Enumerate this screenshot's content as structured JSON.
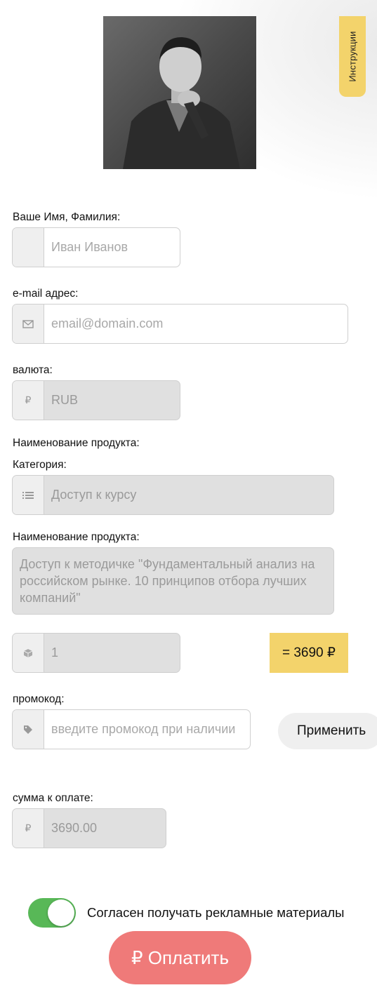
{
  "header": {
    "instructions_tab": "Инструкции"
  },
  "form": {
    "name": {
      "label": "Ваше Имя, Фамилия:",
      "placeholder": "Иван Иванов"
    },
    "email": {
      "label": "e-mail адрес:",
      "placeholder": "email@domain.com",
      "icon": "envelope-icon"
    },
    "currency": {
      "label": "валюта:",
      "value": "RUB",
      "icon": "₽"
    },
    "product_section_label": "Наименование продукта:",
    "category": {
      "label": "Категория:",
      "value": "Доступ к курсу",
      "icon": "list-icon"
    },
    "product": {
      "label": "Наименование продукта:",
      "value": "Доступ к методичке \"Фундаментальный анализ на российском рынке. 10 принципов отбора лучших компаний\""
    },
    "quantity": {
      "value": "1",
      "icon": "box-icon"
    },
    "price": "= 3690 ₽",
    "promo": {
      "label": "промокод:",
      "placeholder": "введите промокод при наличии",
      "icon": "tag-icon",
      "apply_label": "Применить"
    },
    "total": {
      "label": "сумма к оплате:",
      "value": "3690.00",
      "icon": "₽"
    },
    "consent": {
      "label": "Согласен получать рекламные материалы",
      "checked": true
    },
    "pay_button": "₽ Оплатить"
  },
  "colors": {
    "accent_yellow": "#f3d36b",
    "toggle_green": "#58b857",
    "pay_red": "#ef7a79"
  }
}
